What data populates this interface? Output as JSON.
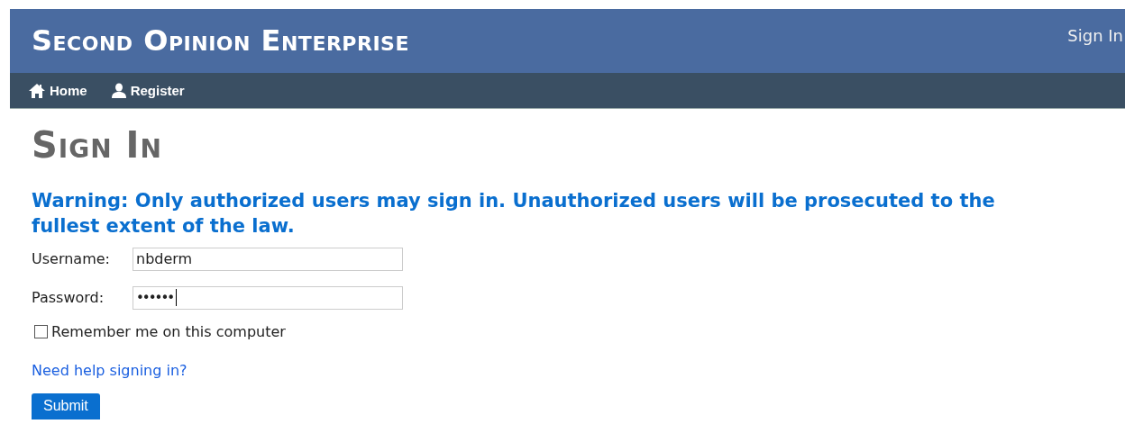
{
  "header": {
    "title": "Second Opinion Enterprise",
    "sign_in_link": "Sign In"
  },
  "nav": [
    {
      "label": "Home",
      "kind": "home"
    },
    {
      "label": "Register",
      "kind": "account"
    }
  ],
  "page_title": "Sign In",
  "warning": "Warning: Only authorized users may sign in. Unauthorized users will be prosecuted to the fullest extent of the law.",
  "form": {
    "username": {
      "label": "Username:",
      "value": "nbderm"
    },
    "password": {
      "label": "Password:",
      "value": "••••••",
      "focused": true
    },
    "remember": {
      "label": "Remember me on this computer",
      "checked": false
    },
    "help_link": "Need help signing in?",
    "submit": "Submit"
  }
}
